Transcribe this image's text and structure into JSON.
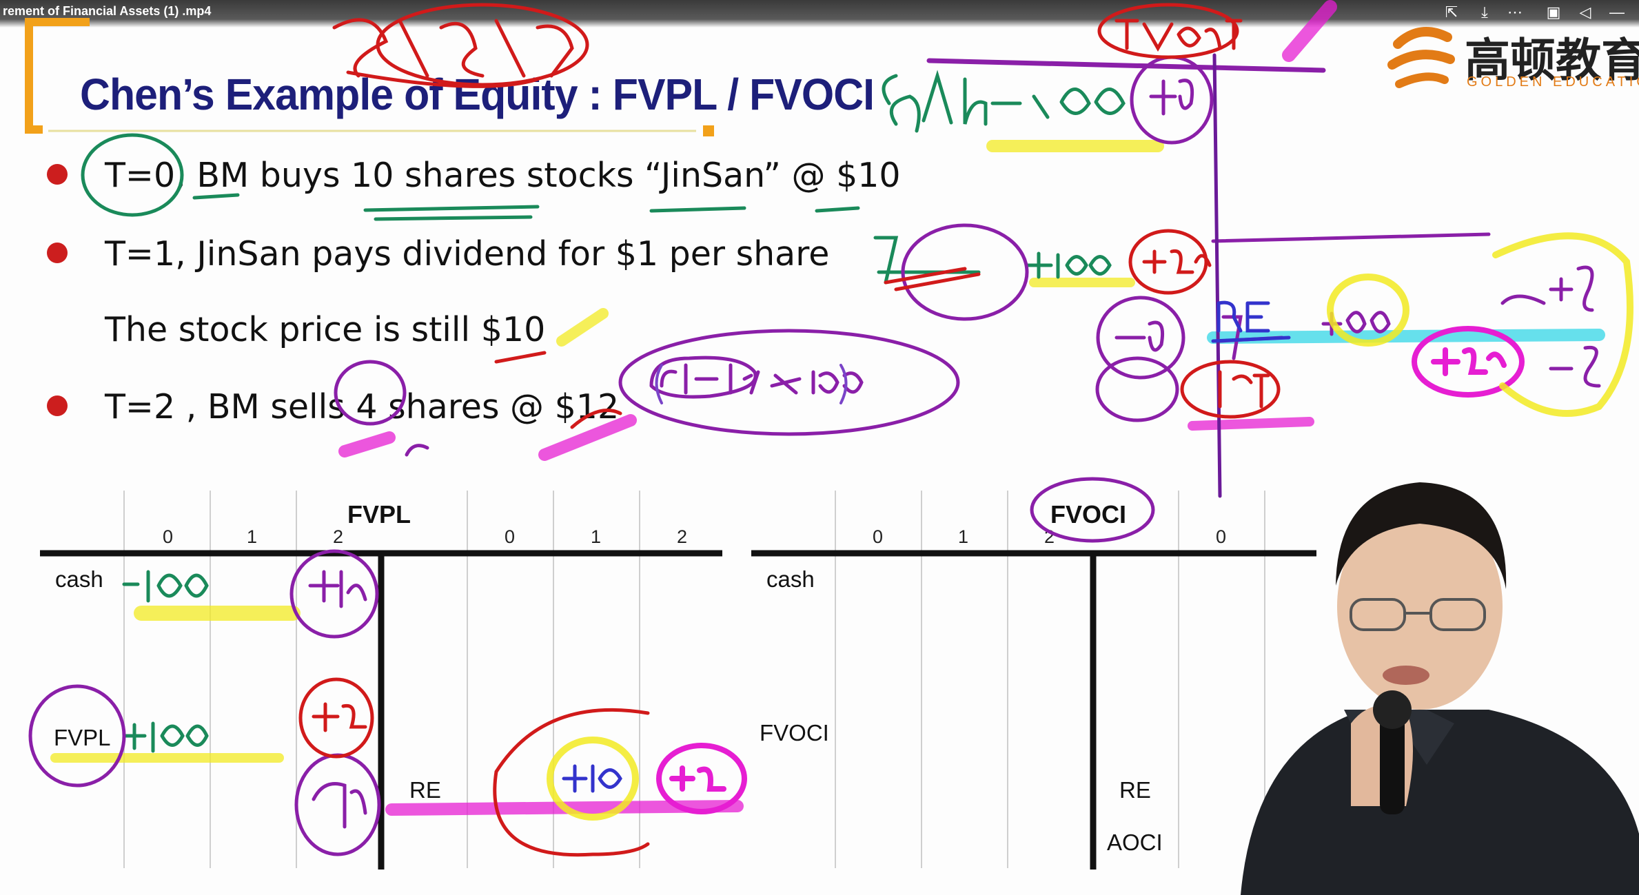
{
  "window": {
    "title": "rement of Financial Assets  (1)  .mp4",
    "controls": [
      "share-icon",
      "download-icon",
      "more-icon",
      "picture-in-picture-icon",
      "pin-icon",
      "minimize-icon"
    ]
  },
  "slide": {
    "title": "Chen’s Example of Equity : FVPL / FVOCI",
    "bullets": [
      "T=0, BM buys 10 shares stocks “JinSan” @ $10",
      "T=1, JinSan pays dividend for $1 per share",
      "The stock price is still $10",
      "T=2 , BM sells 4 shares @ $12"
    ]
  },
  "logo": {
    "cn": "高顿教育",
    "en": "GOLDEN EDUCATION",
    "accent": "#e27b16"
  },
  "fvpl_table": {
    "title": "FVPL",
    "periods_left": [
      "0",
      "1",
      "2"
    ],
    "periods_right": [
      "0",
      "1",
      "2"
    ],
    "rows_left": [
      "cash",
      "FVPL"
    ],
    "rows_right": [
      "RE"
    ]
  },
  "fvoci_table": {
    "title": "FVOCI",
    "periods_left": [
      "0",
      "1",
      "2"
    ],
    "periods_right": [
      "0"
    ],
    "rows_left": [
      "cash",
      "FVOCI"
    ],
    "rows_right": [
      "RE",
      "AOCI"
    ]
  },
  "colors": {
    "title_blue": "#1d1f7a",
    "bullet_red": "#cc1e1e",
    "ink_green": "#1a8a5a",
    "ink_purple": "#8a1fa8",
    "ink_red": "#d11a1a",
    "ink_blue": "#3333cc",
    "highlight_yellow": "#f2ea22",
    "highlight_magenta": "#e61ed2",
    "highlight_cyan": "#33d6e6"
  }
}
